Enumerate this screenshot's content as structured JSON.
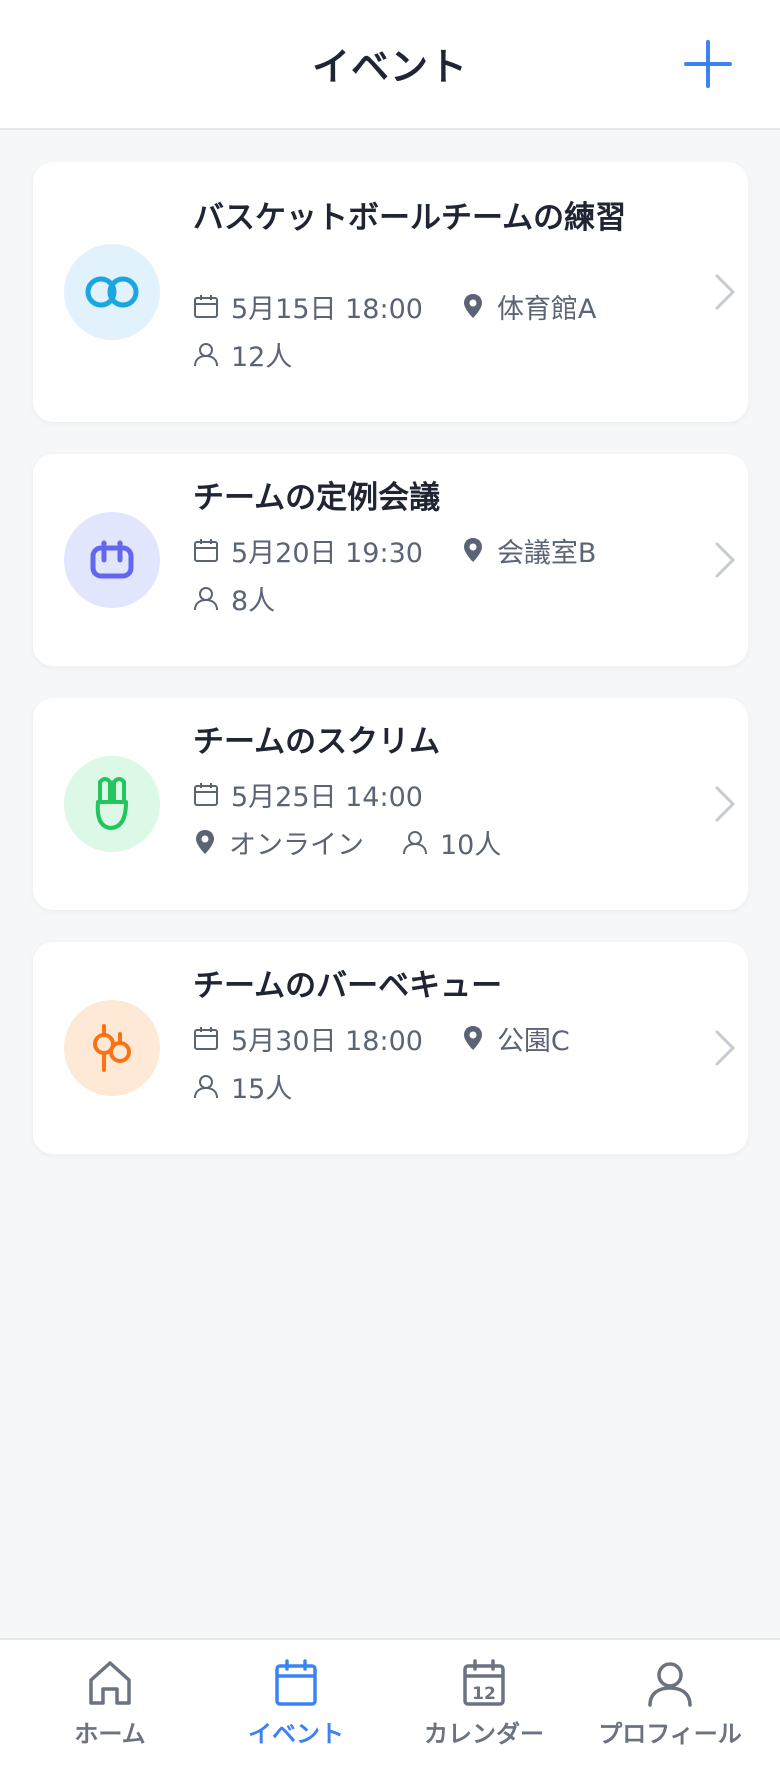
{
  "header": {
    "title": "イベント",
    "add_icon": "plus-icon"
  },
  "events": [
    {
      "title": "バスケットボールチームの練習",
      "date": "5月15日 18:00",
      "location": "体育館A",
      "attendees": "12人",
      "icon": "interlocking-rings-icon",
      "icon_color": "#1aa6e0",
      "icon_bg": "#e2f2fd"
    },
    {
      "title": "チームの定例会議",
      "date": "5月20日 19:30",
      "location": "会議室B",
      "attendees": "8人",
      "icon": "meeting-icon",
      "icon_color": "#6366f1",
      "icon_bg": "#e2e6fc"
    },
    {
      "title": "チームのスクリム",
      "date": "5月25日 14:00",
      "location": "オンライン",
      "attendees": "10人",
      "icon": "scrum-icon",
      "icon_color": "#22c55e",
      "icon_bg": "#dcf8e6"
    },
    {
      "title": "チームのバーベキュー",
      "date": "5月30日 18:00",
      "location": "公園C",
      "attendees": "15人",
      "icon": "bbq-icon",
      "icon_color": "#f97316",
      "icon_bg": "#fde9d6"
    }
  ],
  "tabs": [
    {
      "label": "ホーム",
      "icon": "home-icon",
      "active": false
    },
    {
      "label": "イベント",
      "icon": "calendar-icon",
      "active": true
    },
    {
      "label": "カレンダー",
      "icon": "calendar-day-icon",
      "active": false,
      "day": "12"
    },
    {
      "label": "プロフィール",
      "icon": "user-icon",
      "active": false
    }
  ],
  "colors": {
    "accent": "#3b82f6",
    "text_primary": "#1f2533",
    "text_secondary": "#5b6475",
    "background": "#f6f7f9"
  }
}
